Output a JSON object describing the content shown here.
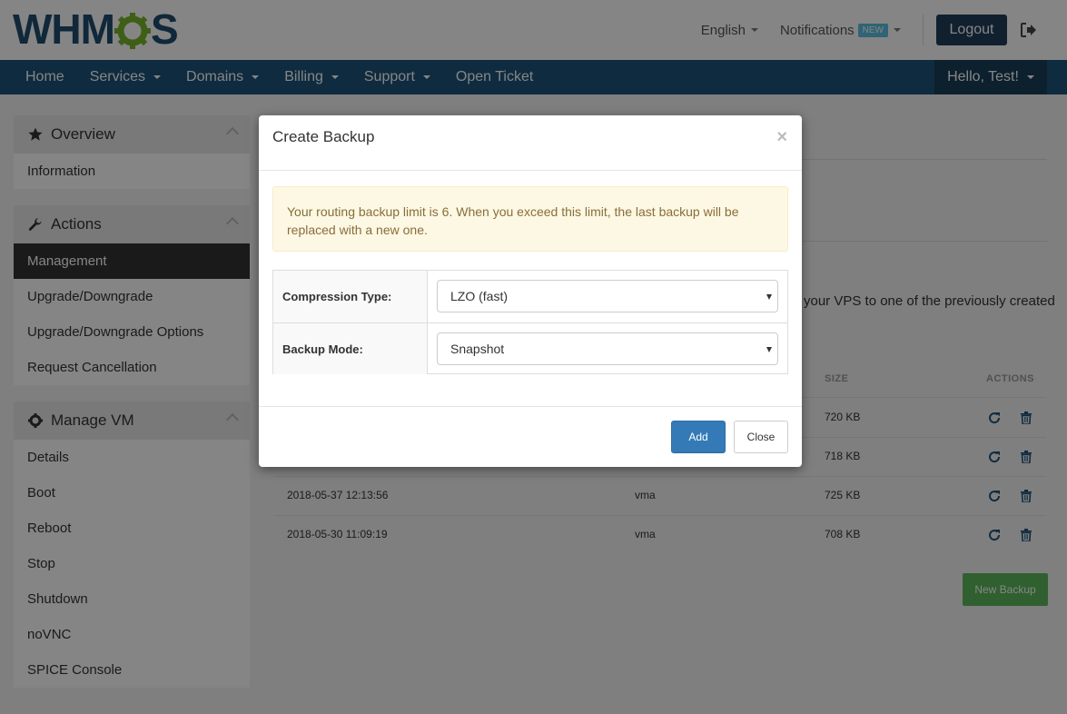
{
  "header": {
    "logo_text_left": "WHM",
    "logo_text_right": "S",
    "language": "English",
    "notifications": "Notifications",
    "new_badge": "NEW",
    "logout": "Logout"
  },
  "nav": {
    "items": [
      {
        "label": "Home",
        "dropdown": false
      },
      {
        "label": "Services",
        "dropdown": true
      },
      {
        "label": "Domains",
        "dropdown": true
      },
      {
        "label": "Billing",
        "dropdown": true
      },
      {
        "label": "Support",
        "dropdown": true
      },
      {
        "label": "Open Ticket",
        "dropdown": false
      }
    ],
    "user_menu": "Hello, Test!"
  },
  "sidebar": {
    "overview": {
      "title": "Overview",
      "items": [
        "Information"
      ]
    },
    "actions": {
      "title": "Actions",
      "items": [
        "Management",
        "Upgrade/Downgrade",
        "Upgrade/Downgrade Options",
        "Request Cancellation"
      ],
      "active": "Management"
    },
    "manage_vm": {
      "title": "Manage VM",
      "items": [
        "Details",
        "Boot",
        "Reboot",
        "Stop",
        "Shutdown",
        "noVNC",
        "SPICE Console"
      ]
    }
  },
  "main": {
    "partial_text": "your VPS to one of the previously created",
    "table": {
      "columns": {
        "size": "SIZE",
        "actions": "ACTIONS"
      },
      "rows": [
        {
          "date": "",
          "format": "",
          "size": "720 KB"
        },
        {
          "date": "",
          "format": "",
          "size": "718 KB"
        },
        {
          "date": "2018-05-37 12:13:56",
          "format": "vma",
          "size": "725 KB"
        },
        {
          "date": "2018-05-30 11:09:19",
          "format": "vma",
          "size": "708 KB"
        }
      ]
    },
    "new_backup": "New Backup"
  },
  "modal": {
    "title": "Create Backup",
    "close_x": "×",
    "alert": "Your routing backup limit is 6. When you exceed this limit, the last backup will be replaced with a new one.",
    "compression_label": "Compression Type:",
    "compression_value": "LZO (fast)",
    "backup_mode_label": "Backup Mode:",
    "backup_mode_value": "Snapshot",
    "add": "Add",
    "close": "Close"
  },
  "colors": {
    "nav_bg": "#1d5479",
    "primary": "#337ab7",
    "success": "#5cb85c",
    "warning_bg": "#fcf8e3"
  }
}
